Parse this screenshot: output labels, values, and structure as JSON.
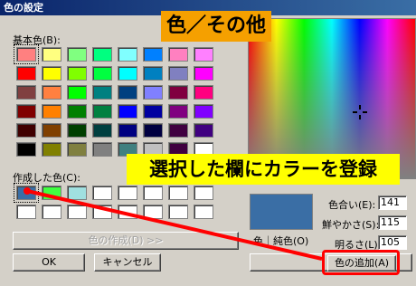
{
  "window": {
    "title": "色の設定"
  },
  "labels": {
    "basic_colors": "基本色(B):",
    "custom_colors": "作成した色(C):",
    "color_solid": "色｜純色(O)",
    "hue": "色合い(E):",
    "sat": "鮮やかさ(S):",
    "lum": "明るさ(L):"
  },
  "values": {
    "hue": "141",
    "sat": "115",
    "lum": "105"
  },
  "buttons": {
    "define_custom": "色の作成(D) >>",
    "ok": "OK",
    "cancel": "キャンセル",
    "add_custom": "色の追加(A)"
  },
  "annotations": {
    "title_banner": "色／その他",
    "instruction": "選択した欄にカラーを登録"
  },
  "colors": {
    "basic": [
      "#ff8080",
      "#ffff80",
      "#80ff80",
      "#00ff80",
      "#80ffff",
      "#0080ff",
      "#ff80c0",
      "#ff80ff",
      "#ff0000",
      "#ffff00",
      "#80ff00",
      "#00ff40",
      "#00ffff",
      "#0080c0",
      "#8080c0",
      "#ff00ff",
      "#804040",
      "#ff8040",
      "#00ff00",
      "#008080",
      "#004080",
      "#8080ff",
      "#800040",
      "#ff0080",
      "#800000",
      "#ff8000",
      "#008000",
      "#008040",
      "#0000ff",
      "#0000a0",
      "#800080",
      "#8000ff",
      "#400000",
      "#804000",
      "#004000",
      "#004040",
      "#000080",
      "#000040",
      "#400040",
      "#400080",
      "#000000",
      "#808000",
      "#808040",
      "#808080",
      "#408080",
      "#c0c0c0",
      "#400040",
      "#ffffff"
    ],
    "custom": [
      "#3a6ea5",
      "#40ff40",
      "#a0e0e0",
      "#ffffff",
      "#ffffff",
      "#ffffff",
      "#ffffff",
      "#ffffff",
      "#ffffff",
      "#ffffff",
      "#ffffff",
      "#ffffff",
      "#ffffff",
      "#ffffff",
      "#ffffff",
      "#ffffff"
    ],
    "accent_red": "#ff0000",
    "banner_orange": "#f5a000",
    "banner_yellow": "#ffff00"
  }
}
